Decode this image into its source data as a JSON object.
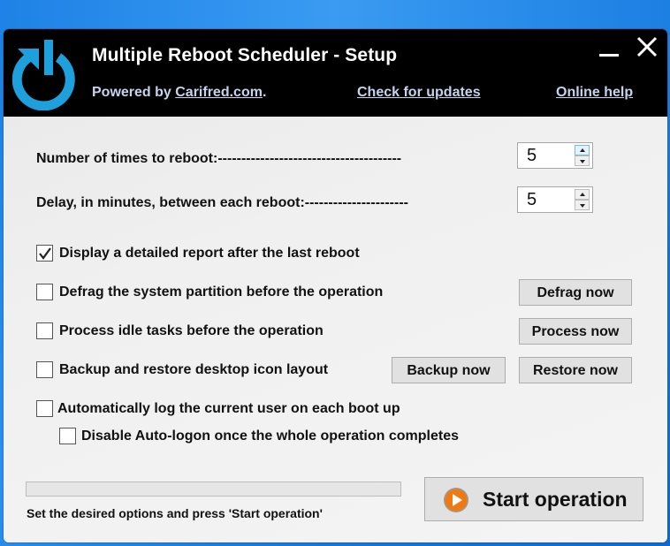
{
  "window": {
    "title": "Multiple Reboot Scheduler - Setup",
    "powered_by_prefix": "Powered by ",
    "powered_by_link": "Carifred.com",
    "powered_by_suffix": ".",
    "check_updates_link": "Check for updates",
    "online_help_link": "Online help",
    "minimize_icon": "minimize-icon",
    "close_icon": "close-icon",
    "logo_icon": "power-restart-icon"
  },
  "settings": {
    "reboot_count": {
      "label": "Number of times to reboot:---------------------------------------",
      "value": "5"
    },
    "delay_minutes": {
      "label": "Delay, in minutes, between each reboot:----------------------",
      "value": "5"
    }
  },
  "options": [
    {
      "label": "Display a detailed report after the last reboot",
      "checked": true
    },
    {
      "label": "Defrag the system partition before the operation",
      "checked": false
    },
    {
      "label": "Process idle tasks before the operation",
      "checked": false
    },
    {
      "label": "Backup and restore desktop icon layout",
      "checked": false
    },
    {
      "label": "Automatically log the current user on each boot up",
      "checked": false
    },
    {
      "label": "Disable Auto-logon once the whole operation completes",
      "checked": false
    }
  ],
  "buttons": {
    "defrag_now": "Defrag now",
    "process_now": "Process now",
    "backup_now": "Backup now",
    "restore_now": "Restore now",
    "start_operation": "Start operation"
  },
  "progress": {
    "percent": 0
  },
  "status_text": "Set the desired options and press 'Start operation'",
  "colors": {
    "header_bg": "#000000",
    "logo_blue": "#1ea0dc",
    "link_color": "#c7d3ee",
    "start_icon_orange": "#f07a12",
    "desktop_blue": "#1a7fe0"
  }
}
